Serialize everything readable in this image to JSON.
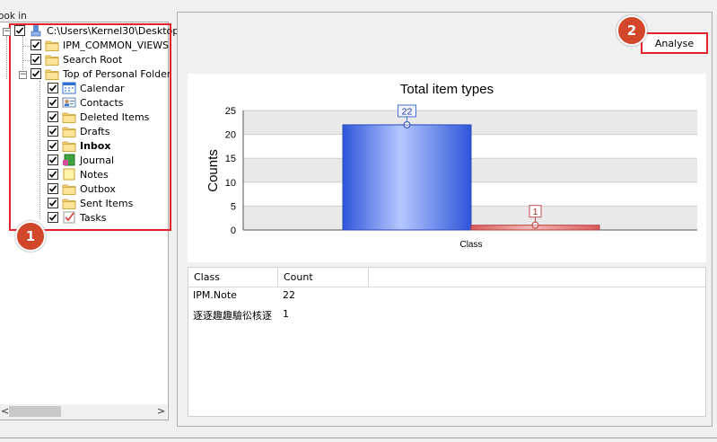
{
  "left_panel": {
    "look_in_label": "ook in",
    "tree": [
      {
        "label": "C:\\Users\\Kernel30\\Desktop",
        "icon": "pst-file-icon",
        "bold": false
      },
      {
        "label": "IPM_COMMON_VIEWS",
        "icon": "folder-icon",
        "bold": false
      },
      {
        "label": "Search Root",
        "icon": "folder-icon",
        "bold": false
      },
      {
        "label": "Top of Personal Folder",
        "icon": "folder-icon",
        "bold": false
      },
      {
        "label": "Calendar",
        "icon": "calendar-icon",
        "bold": false
      },
      {
        "label": "Contacts",
        "icon": "contacts-icon",
        "bold": false
      },
      {
        "label": "Deleted Items",
        "icon": "folder-icon",
        "bold": false
      },
      {
        "label": "Drafts",
        "icon": "folder-icon",
        "bold": false
      },
      {
        "label": "Inbox",
        "icon": "folder-icon",
        "bold": true
      },
      {
        "label": "Journal",
        "icon": "journal-icon",
        "bold": false
      },
      {
        "label": "Notes",
        "icon": "notes-icon",
        "bold": false
      },
      {
        "label": "Outbox",
        "icon": "folder-icon",
        "bold": false
      },
      {
        "label": "Sent Items",
        "icon": "folder-icon",
        "bold": false
      },
      {
        "label": "Tasks",
        "icon": "tasks-icon",
        "bold": false
      }
    ],
    "badge": "1",
    "scroll_left": "<",
    "scroll_right": ">",
    "expander_symbol": "−"
  },
  "toolbar": {
    "badge": "2",
    "analyse_label": "Analyse"
  },
  "chart_data": {
    "type": "bar",
    "title": "Total item types",
    "xlabel": "Class",
    "ylabel": "Counts",
    "ylim": [
      0,
      25
    ],
    "yticks": [
      0,
      5,
      10,
      15,
      20,
      25
    ],
    "grid": true,
    "series": [
      {
        "values": [
          22
        ],
        "color": "#3f66e0"
      },
      {
        "values": [
          1
        ],
        "color": "#e06c6c"
      }
    ],
    "data_labels": [
      "22",
      "1"
    ]
  },
  "grid": {
    "headers": [
      "Class",
      "Count"
    ],
    "rows": [
      {
        "class": "IPM.Note",
        "count": "22"
      },
      {
        "class": "逐逐趣趣驗彸核逐",
        "count": "1"
      }
    ]
  }
}
